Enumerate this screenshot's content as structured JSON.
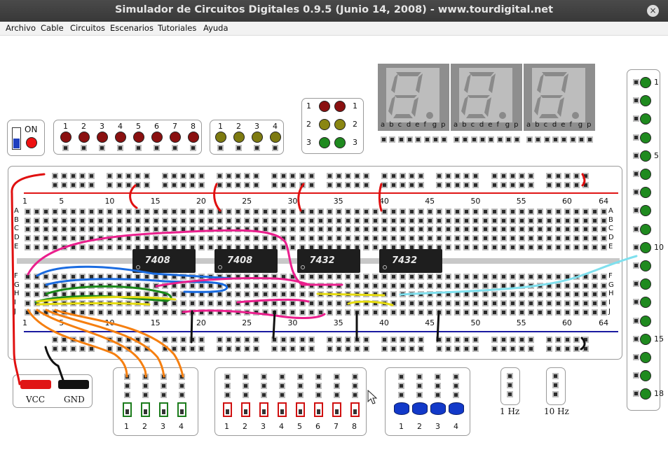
{
  "window": {
    "title": "Simulador de Circuitos Digitales 0.9.5 (Junio 14, 2008) - www.tourdigital.net",
    "close_glyph": "×"
  },
  "menu": [
    "Archivo",
    "Cable",
    "Circuitos",
    "Escenarios",
    "Tutoriales",
    "Ayuda"
  ],
  "power": {
    "label": "ON"
  },
  "leds_red": {
    "labels": [
      "1",
      "2",
      "3",
      "4",
      "5",
      "6",
      "7",
      "8"
    ],
    "color": "#8a1010"
  },
  "leds_olive": {
    "labels": [
      "1",
      "2",
      "3",
      "4"
    ],
    "color": "#7d7a10"
  },
  "traffic": {
    "labels": [
      "1",
      "2",
      "3"
    ],
    "colors": [
      "#8a1010",
      "#8a8612",
      "#1f8a1f"
    ]
  },
  "display": {
    "digits": 3,
    "segment_labels": [
      "a",
      "b",
      "c",
      "d",
      "e",
      "f",
      "g",
      "p"
    ]
  },
  "breadboard": {
    "column_numbers": [
      "1",
      "5",
      "10",
      "15",
      "20",
      "25",
      "30",
      "35",
      "40",
      "45",
      "50",
      "55",
      "60",
      "64"
    ],
    "top_rows": [
      "A",
      "B",
      "C",
      "D",
      "E"
    ],
    "bottom_rows": [
      "F",
      "G",
      "H",
      "I",
      "J"
    ],
    "chips": [
      "7408",
      "7408",
      "7432",
      "7432"
    ],
    "colors": {
      "positive_rail": "#e01515",
      "negative_rail": "#1a1aa0"
    }
  },
  "power_terminals": {
    "vcc": "VCC",
    "gnd": "GND"
  },
  "switches_green": {
    "labels": [
      "1",
      "2",
      "3",
      "4"
    ]
  },
  "switches_red": {
    "labels": [
      "1",
      "2",
      "3",
      "4",
      "5",
      "6",
      "7",
      "8"
    ]
  },
  "buttons": {
    "labels": [
      "1",
      "2",
      "3",
      "4"
    ]
  },
  "clocks": [
    "1 Hz",
    "10 Hz"
  ],
  "output_leds": {
    "labels": [
      "1",
      "5",
      "10",
      "15",
      "18"
    ],
    "count": 18,
    "color": "#1f8a1f"
  }
}
